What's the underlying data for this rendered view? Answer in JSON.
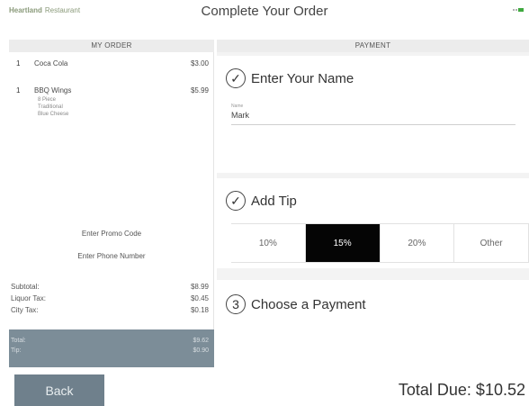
{
  "header": {
    "brand_part1": "Heartland",
    "brand_part2": "Restaurant",
    "title": "Complete Your Order"
  },
  "order": {
    "heading": "MY ORDER",
    "items": [
      {
        "qty": "1",
        "name": "Coca Cola",
        "price": "$3.00",
        "mods": []
      },
      {
        "qty": "1",
        "name": "BBQ Wings",
        "price": "$5.99",
        "mods": [
          "8 Piece",
          "Traditional",
          "Blue Cheese"
        ]
      }
    ],
    "promo_label": "Enter Promo Code",
    "phone_label": "Enter Phone Number",
    "subtotal_label": "Subtotal:",
    "subtotal_value": "$8.99",
    "liquor_label": "Liquor Tax:",
    "liquor_value": "$0.45",
    "city_label": "City Tax:",
    "city_value": "$0.18",
    "total_label": "Total:",
    "total_value": "$9.62",
    "tip_label": "Tip:",
    "tip_value": "$0.90"
  },
  "payment": {
    "heading": "PAYMENT",
    "step1_title": "Enter Your Name",
    "name_field_label": "Name",
    "name_field_value": "Mark",
    "step2_title": "Add Tip",
    "tip_options": [
      "10%",
      "15%",
      "20%",
      "Other"
    ],
    "tip_selected": "15%",
    "step3_number": "3",
    "step3_title": "Choose a Payment"
  },
  "footer": {
    "back_label": "Back",
    "total_due": "Total Due: $10.52"
  },
  "colors": {
    "selected_tip": "#050505",
    "total_box": "#7c8d98",
    "back_button": "#6f808c"
  }
}
